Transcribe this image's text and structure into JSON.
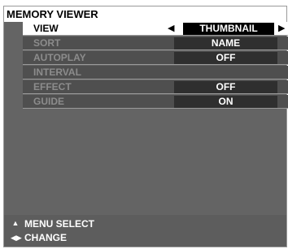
{
  "window": {
    "title": "MEMORY VIEWER"
  },
  "menu": {
    "items": [
      {
        "label": "VIEW",
        "value": "THUMBNAIL",
        "selected": true
      },
      {
        "label": "SORT",
        "value": "NAME"
      },
      {
        "label": "AUTOPLAY",
        "value": "OFF"
      },
      {
        "label": "INTERVAL",
        "value": ""
      },
      {
        "label": "EFFECT",
        "value": "OFF"
      },
      {
        "label": "GUIDE",
        "value": "ON"
      }
    ]
  },
  "footer": {
    "lines": [
      {
        "icon": "up-down-arrows-icon",
        "text": "MENU SELECT"
      },
      {
        "icon": "left-right-arrows-icon",
        "text": "CHANGE"
      }
    ]
  },
  "colors": {
    "background": "#646464",
    "row_background": "#4f4f4f",
    "value_background": "#2f2f2f",
    "selected_row": "#ffffff",
    "selected_value": "#000000"
  }
}
